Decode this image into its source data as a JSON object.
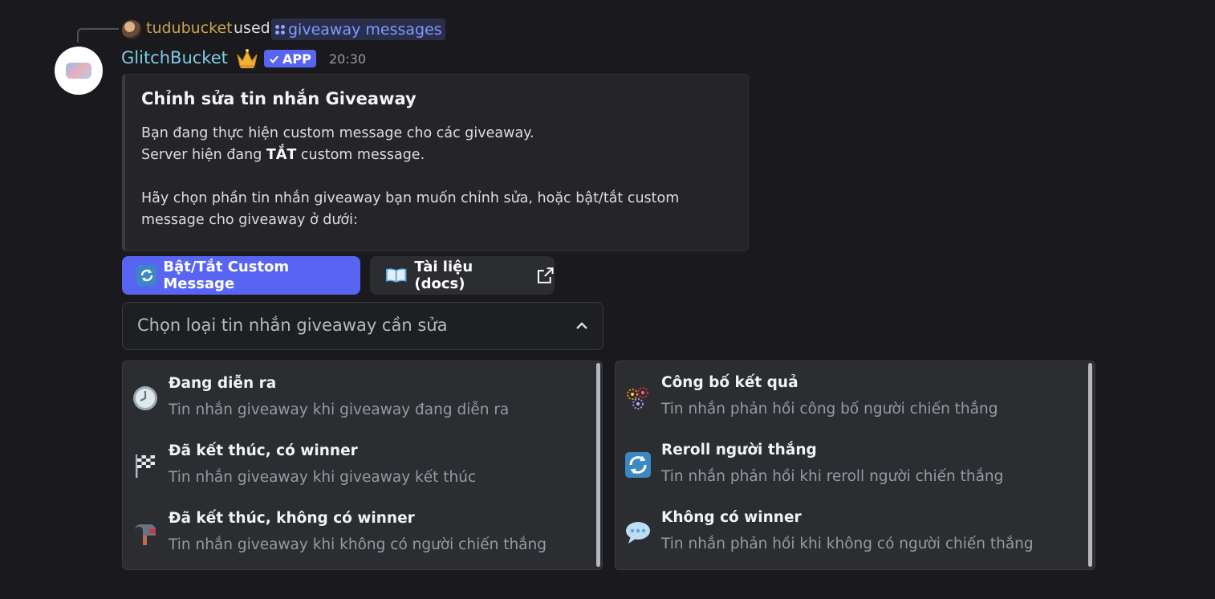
{
  "reply": {
    "username": "tudubucket",
    "action": "used",
    "command": "giveaway messages"
  },
  "message": {
    "author": "GlitchBucket",
    "badge": "APP",
    "timestamp": "20:30"
  },
  "embed": {
    "title": "Chỉnh sửa tin nhắn Giveaway",
    "line1": "Bạn đang thực hiện custom message cho các giveaway.",
    "line2_pre": "Server hiện đang ",
    "line2_bold": "TẮT",
    "line2_post": " custom message.",
    "line3": "Hãy chọn phần tin nhắn giveaway bạn muốn chỉnh sửa, hoặc bật/tắt custom",
    "line4": "message cho giveaway ở dưới:"
  },
  "buttons": {
    "toggle_label": "Bật/Tắt Custom Message",
    "docs_label": "Tài liệu (docs)"
  },
  "select": {
    "placeholder": "Chọn loại tin nhắn giveaway cần sửa"
  },
  "options_left": [
    {
      "label": "Đang diễn ra",
      "desc": "Tin nhắn giveaway khi giveaway đang diễn ra",
      "icon": "clock-icon"
    },
    {
      "label": "Đã kết thúc, có winner",
      "desc": "Tin nhắn giveaway khi giveaway kết thúc",
      "icon": "checkered-flag-icon"
    },
    {
      "label": "Đã kết thúc, không có winner",
      "desc": "Tin nhắn giveaway khi không có người chiến thắng",
      "icon": "mailbox-icon"
    }
  ],
  "options_right": [
    {
      "label": "Công bố kết quả",
      "desc": "Tin nhắn phản hồi công bố người chiến thắng",
      "icon": "fireworks-icon"
    },
    {
      "label": "Reroll người thắng",
      "desc": "Tin nhắn phản hồi khi reroll người chiến thắng",
      "icon": "repeat-icon"
    },
    {
      "label": "Không có winner",
      "desc": "Tin nhắn phản hồi khi không có người chiến thắng",
      "icon": "speech-bubble-icon"
    }
  ],
  "colors": {
    "background": "#1a1a1e",
    "blurple": "#5865f2",
    "bot_name": "#7ecbe4",
    "reply_user": "#c9a34a",
    "command_link": "#7c9cff"
  }
}
